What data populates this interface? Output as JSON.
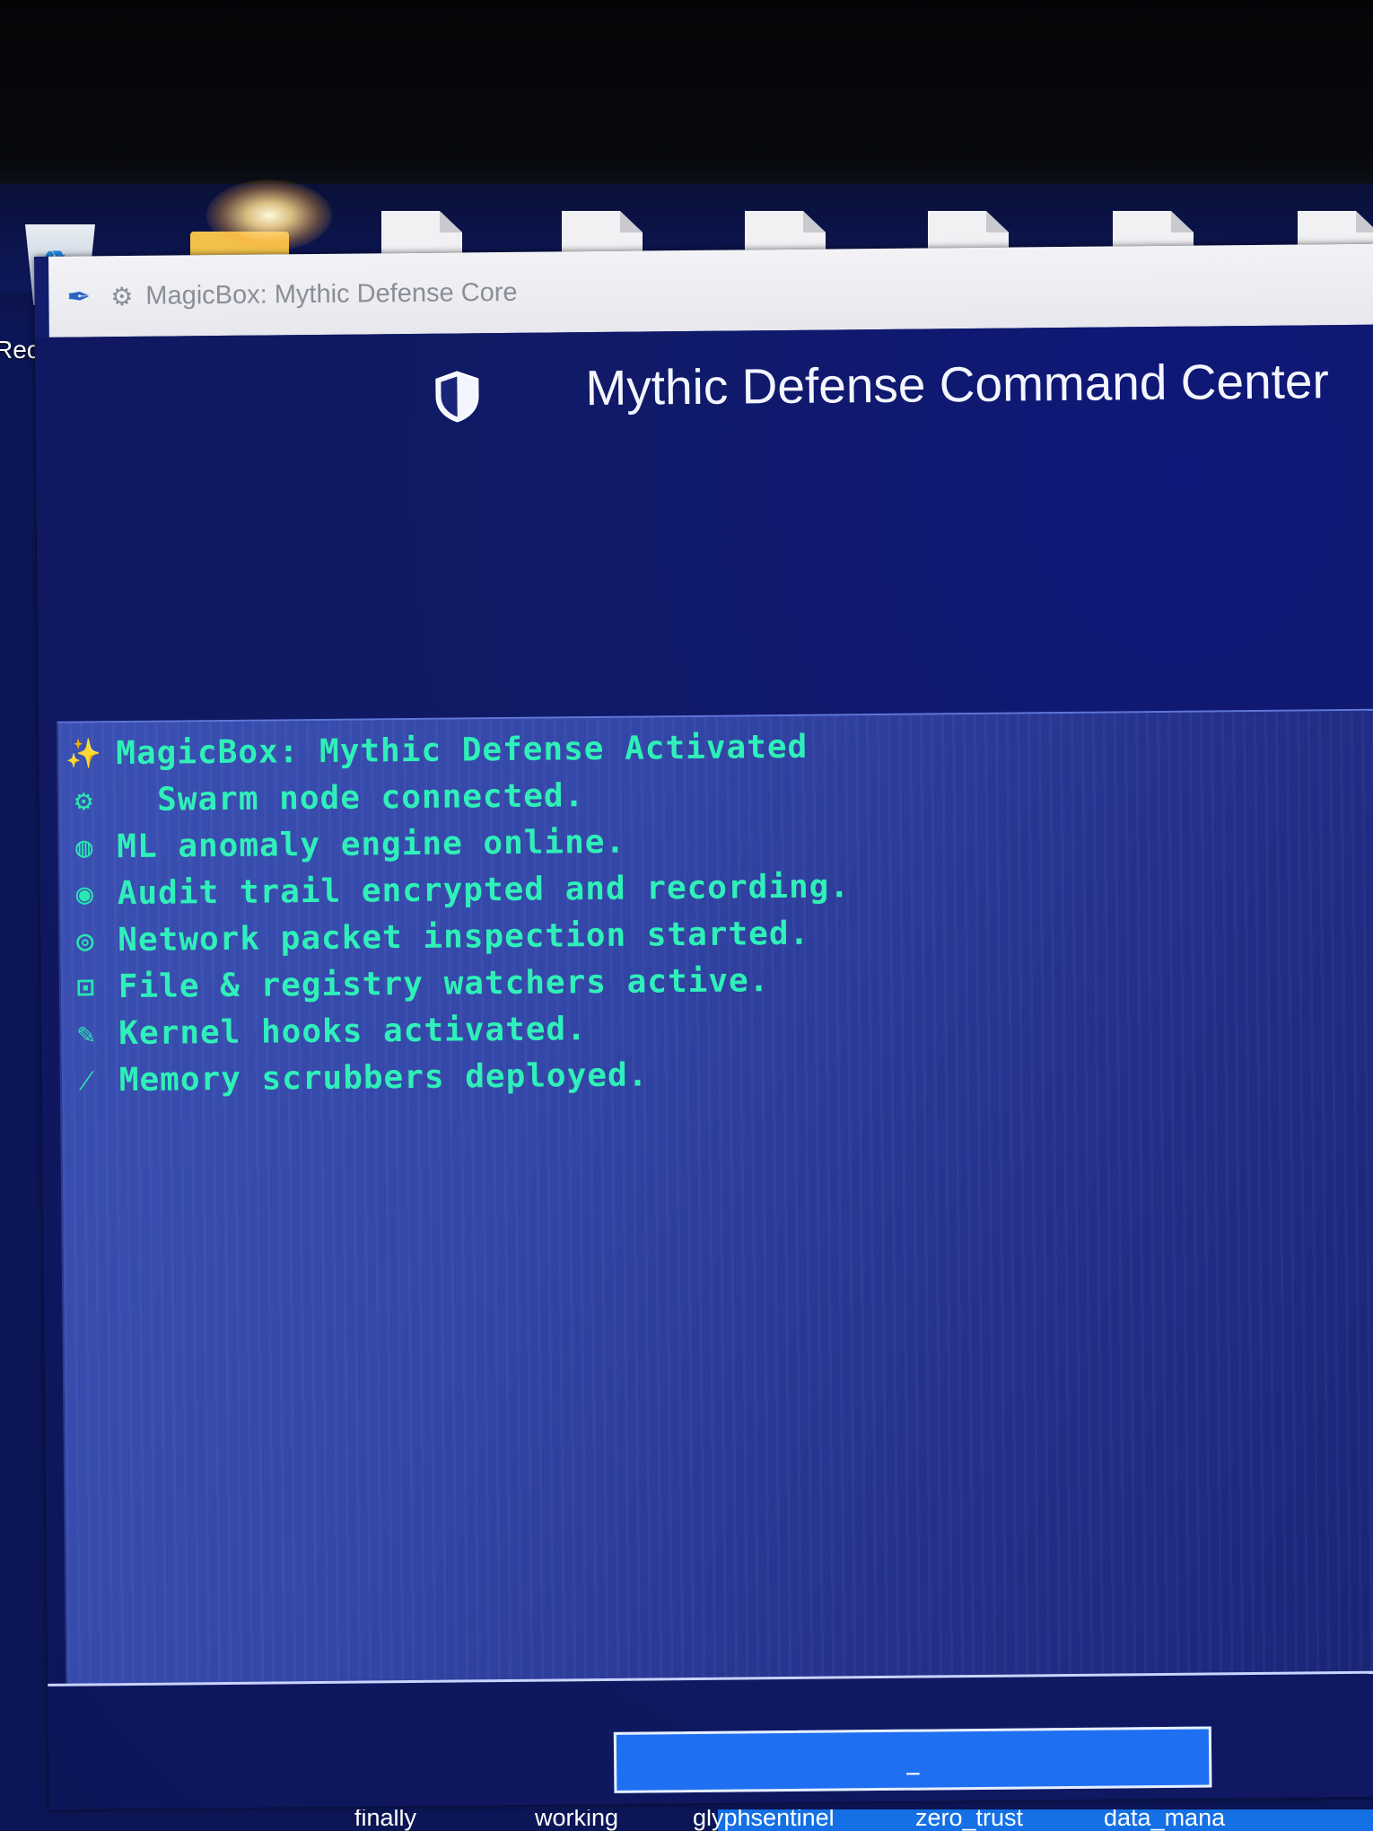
{
  "desktop": {
    "recycle_label": "Recy",
    "taskbar_items": [
      "finally",
      "working",
      "glyphsentinel",
      "zero_trust",
      "data_mana"
    ]
  },
  "window": {
    "title": "MagicBox: Mythic Defense Core"
  },
  "app": {
    "title": "Mythic Defense Command Center",
    "action_button_label": "_"
  },
  "log": [
    {
      "icon": "sparkles-icon",
      "glyph": "✨",
      "text": "MagicBox: Mythic Defense Activated"
    },
    {
      "icon": "swarm-node-icon",
      "glyph": "⚙",
      "text": "  Swarm node connected."
    },
    {
      "icon": "brain-icon",
      "glyph": "◍",
      "text": "ML anomaly engine online."
    },
    {
      "icon": "record-icon",
      "glyph": "◉",
      "text": "Audit trail encrypted and recording."
    },
    {
      "icon": "globe-icon",
      "glyph": "◎",
      "text": "Network packet inspection started."
    },
    {
      "icon": "lock-icon",
      "glyph": "⊡",
      "text": "File & registry watchers active."
    },
    {
      "icon": "syringe-icon",
      "glyph": "✎",
      "text": "Kernel hooks activated."
    },
    {
      "icon": "broom-icon",
      "glyph": "⁄",
      "text": "Memory scrubbers deployed."
    }
  ],
  "colors": {
    "log_text": "#2ff0b8",
    "window_bg": "#121d6d",
    "button_bg": "#1e6ff2"
  }
}
